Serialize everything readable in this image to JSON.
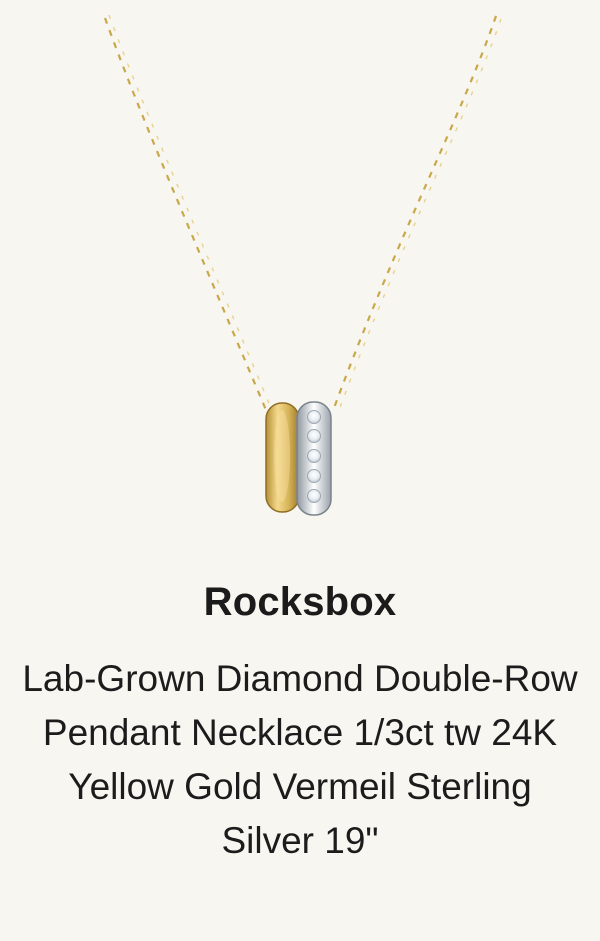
{
  "product": {
    "brand": "Rocksbox",
    "name": "Lab-Grown Diamond Double-Row Pendant Necklace 1/3ct tw 24K Yellow Gold Vermeil Sterling Silver 19\"",
    "image_icon": "necklace-pendant-image"
  },
  "colors": {
    "background": "#f8f6f1",
    "gold": "#d6b45a",
    "silver": "#d9dde2"
  }
}
